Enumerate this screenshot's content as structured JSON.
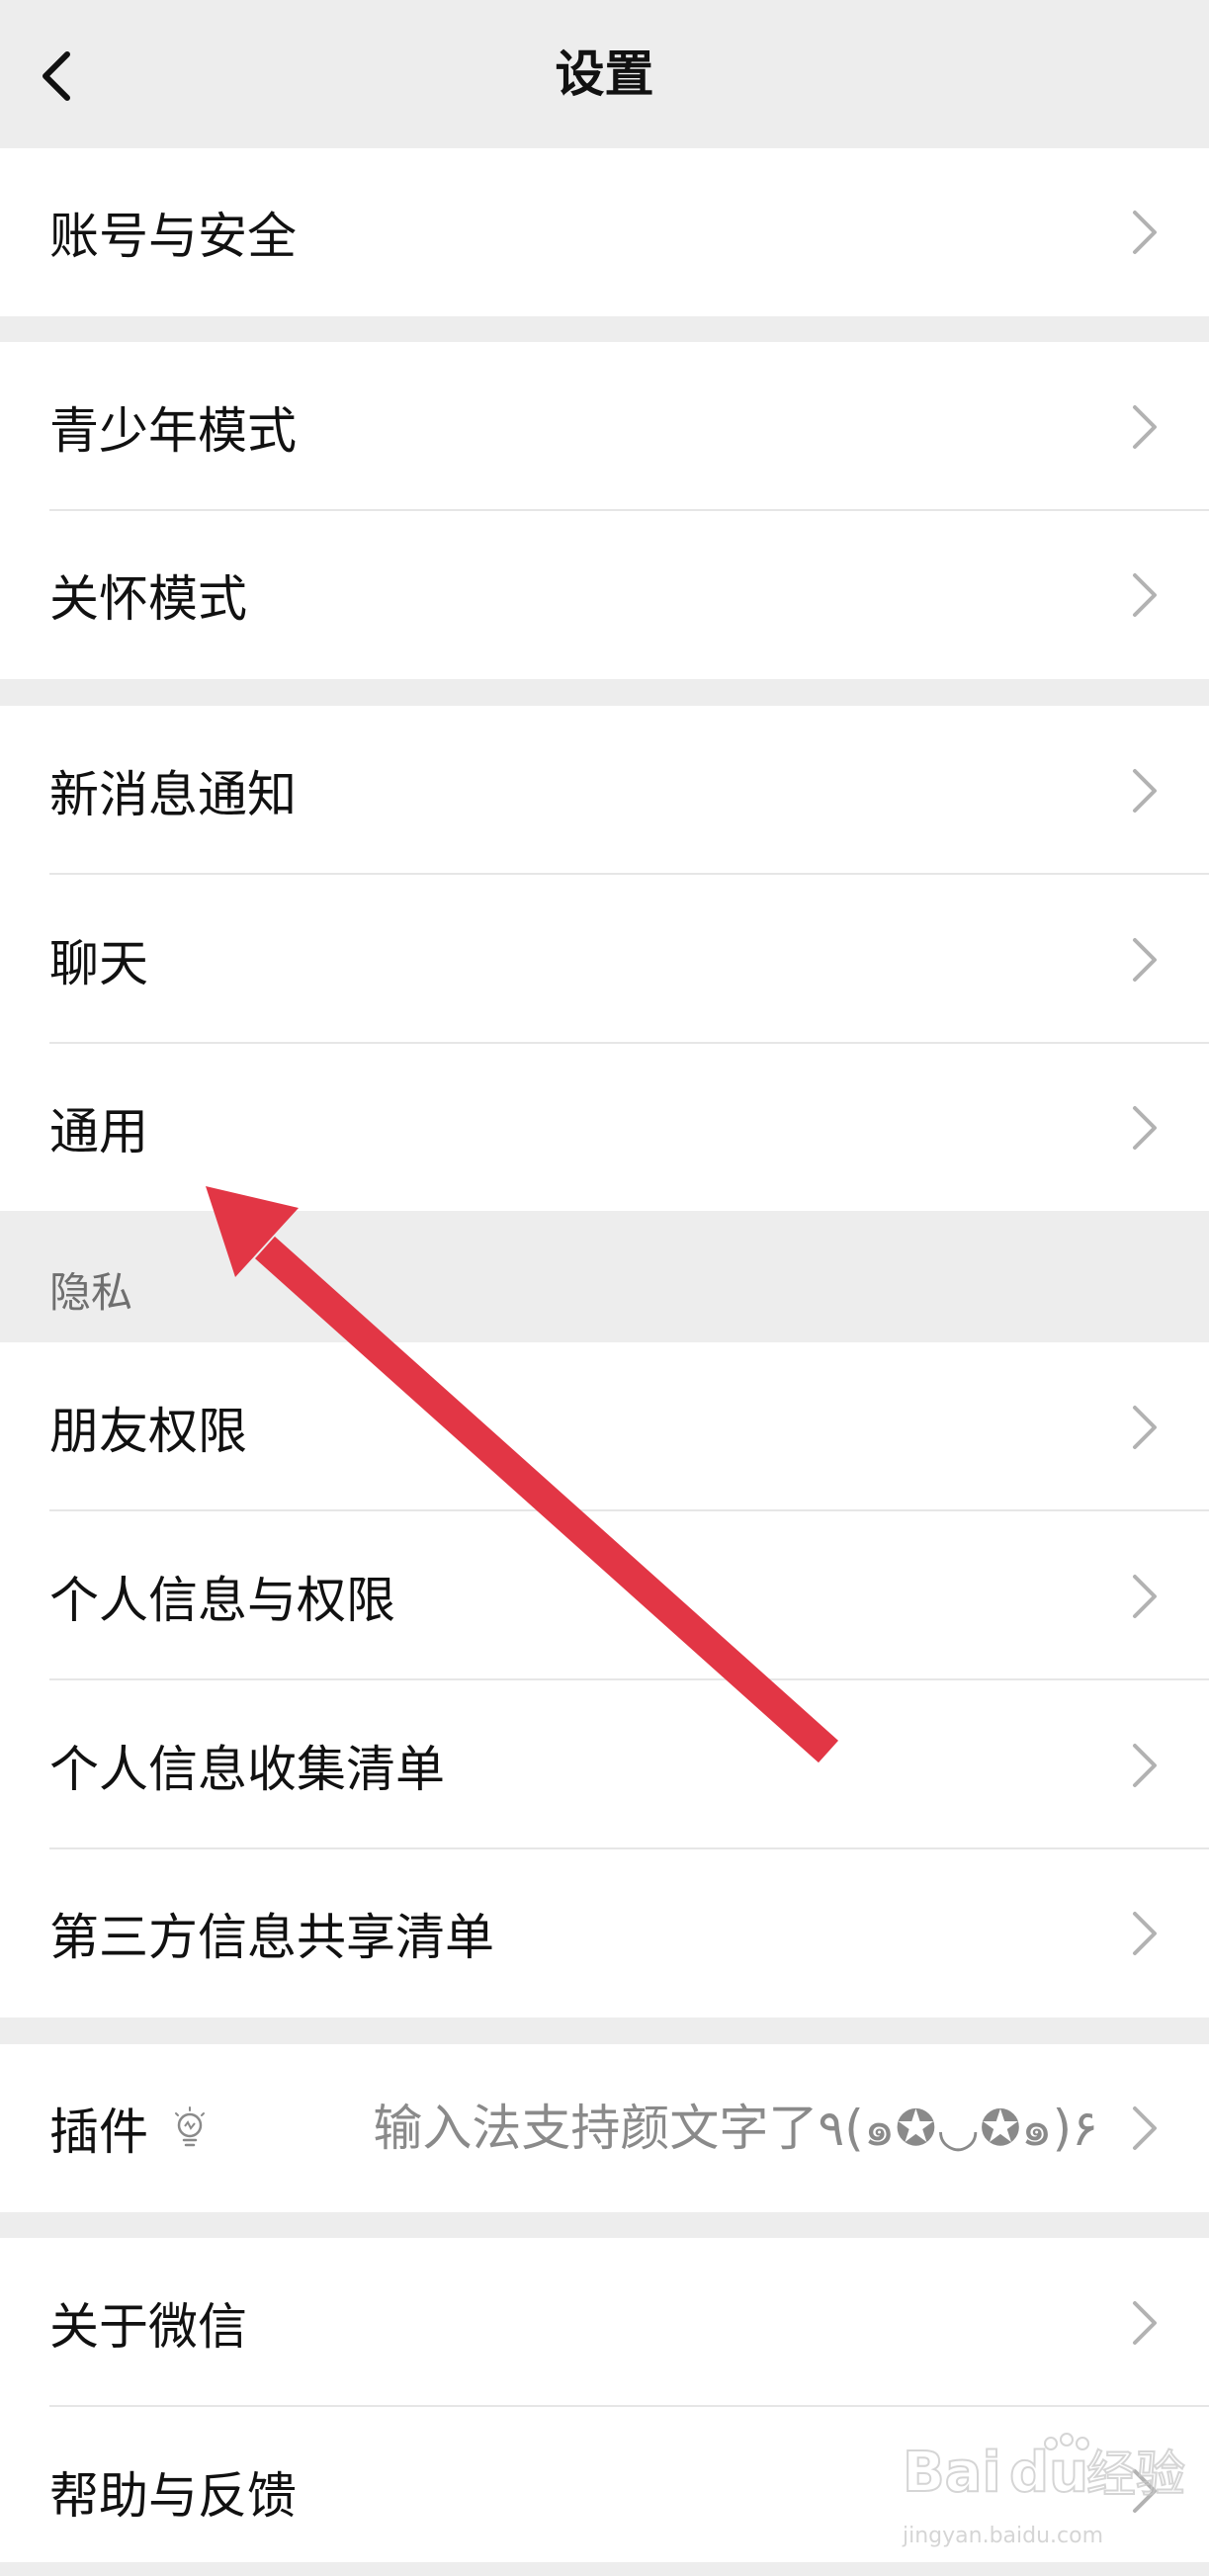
{
  "header": {
    "title": "设置",
    "back_icon": "chevron-left-icon"
  },
  "rows": {
    "account_security": "账号与安全",
    "teen_mode": "青少年模式",
    "care_mode": "关怀模式",
    "new_message_notifications": "新消息通知",
    "chat": "聊天",
    "general": "通用",
    "friend_permissions": "朋友权限",
    "personal_info_permissions": "个人信息与权限",
    "personal_info_collection_list": "个人信息收集清单",
    "third_party_sharing_list": "第三方信息共享清单",
    "plugins": "插件",
    "plugins_value": "输入法支持颜文字了٩(๑✪◡✪๑)۶",
    "about_wechat": "关于微信",
    "help_feedback": "帮助与反馈"
  },
  "sections": {
    "privacy_header": "隐私"
  },
  "icons": {
    "row_chevron": "chevron-right-icon",
    "plugin_badge": "lightbulb-icon"
  },
  "annotation": {
    "arrow_color": "#e23645",
    "points_to": "通用"
  },
  "watermark": {
    "brand": "Baidu经验",
    "url": "jingyan.baidu.com"
  },
  "colors": {
    "background": "#ededed",
    "row_background": "#ffffff",
    "text_primary": "#111111",
    "text_secondary": "#8a8a8a",
    "chevron": "#b2b2b2",
    "arrow": "#e23645"
  }
}
